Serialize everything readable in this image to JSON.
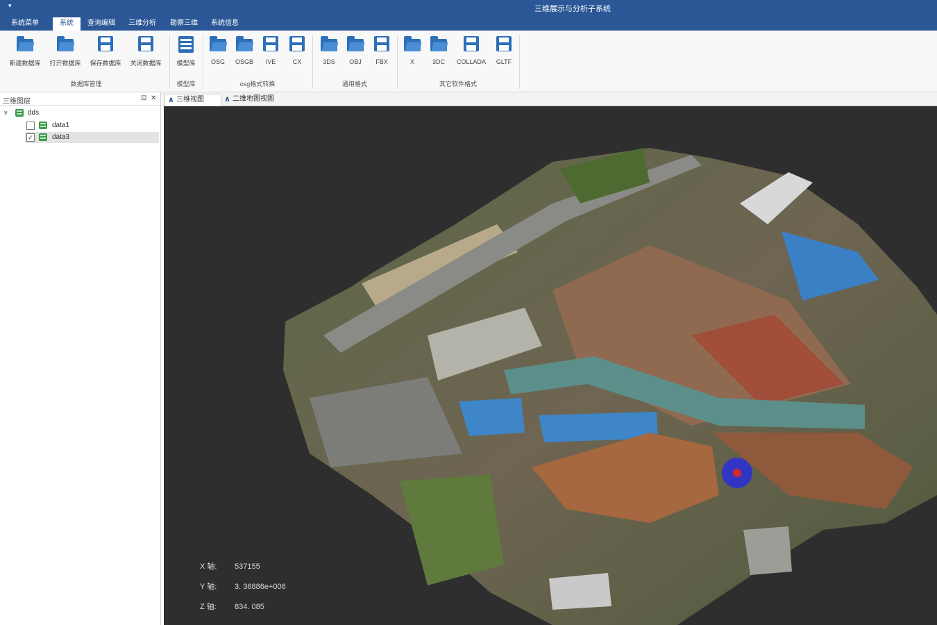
{
  "window": {
    "title": "三维展示与分析子系统",
    "quick_access": "▾"
  },
  "menu": {
    "tabs": [
      {
        "label": "系统菜单"
      },
      {
        "label": "系统"
      },
      {
        "label": "查询编辑"
      },
      {
        "label": "三维分析"
      },
      {
        "label": "勘察三维"
      },
      {
        "label": "系统信息"
      }
    ],
    "active_index": 1
  },
  "ribbon": {
    "groups": [
      {
        "label": "数据库管理",
        "buttons": [
          "新建数据库",
          "打开数据库",
          "保存数据库",
          "关闭数据库"
        ]
      },
      {
        "label": "模型库",
        "buttons": [
          "模型库"
        ]
      },
      {
        "label": "osg格式转换",
        "buttons": [
          "OSG",
          "OSGB",
          "IVE",
          "CX"
        ]
      },
      {
        "label": "通用格式",
        "buttons": [
          "3DS",
          "OBJ",
          "FBX"
        ]
      },
      {
        "label": "其它软件格式",
        "buttons": [
          "X",
          "3DC",
          "COLLADA",
          "GLTF"
        ]
      }
    ]
  },
  "layer_panel": {
    "title": "三维图层",
    "pin_icon": "⊡",
    "close_icon": "✕",
    "root": {
      "label": "dds",
      "expanded": true
    },
    "layers": [
      {
        "label": "data1",
        "checked": false,
        "selected": false
      },
      {
        "label": "data3",
        "checked": true,
        "selected": true
      }
    ]
  },
  "view_tabs": [
    {
      "label": "三维视图",
      "active": true
    },
    {
      "label": "二维地图视图",
      "active": false
    }
  ],
  "coordinates": {
    "x_label": "X 轴:",
    "x_value": "537155",
    "y_label": "Y 轴:",
    "y_value": "3. 36886e+006",
    "z_label": "Z 轴:",
    "z_value": "834. 085"
  },
  "colors": {
    "accent": "#2b5797",
    "icon_blue": "#2d6fb9",
    "viewport_bg": "#2e2e2e"
  }
}
